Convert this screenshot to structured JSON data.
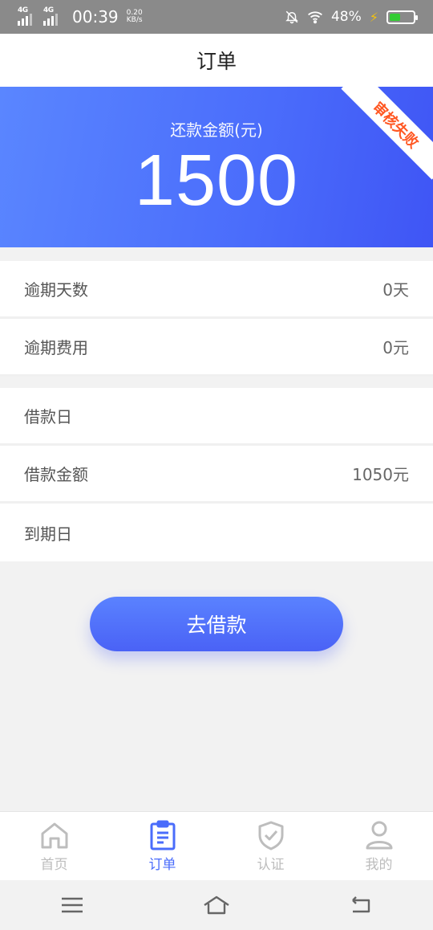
{
  "status_bar": {
    "net1": "4G",
    "net2": "4G",
    "time": "00:39",
    "speed_value": "0.20",
    "speed_unit": "KB/s",
    "battery": "48%",
    "battery_level": 0.48,
    "icons": [
      "signal-icon",
      "mute-bell-icon",
      "wifi-icon",
      "charging-icon",
      "battery-icon"
    ]
  },
  "header": {
    "title": "订单"
  },
  "hero": {
    "label": "还款金额(元)",
    "amount": "1500",
    "ribbon": "审核失败",
    "colors": {
      "start": "#5a86ff",
      "end": "#3f55f5",
      "ribbon_text": "#ff5722"
    }
  },
  "details": {
    "group1": [
      {
        "label": "逾期天数",
        "value": "0天"
      },
      {
        "label": "逾期费用",
        "value": "0元"
      }
    ],
    "group2": [
      {
        "label": "借款日",
        "value": ""
      },
      {
        "label": "借款金额",
        "value": "1050元"
      },
      {
        "label": "到期日",
        "value": ""
      }
    ]
  },
  "cta": {
    "label": "去借款"
  },
  "bottom_nav": {
    "items": [
      {
        "label": "首页",
        "icon": "home-icon",
        "active": false
      },
      {
        "label": "订单",
        "icon": "order-icon",
        "active": true
      },
      {
        "label": "认证",
        "icon": "shield-check-icon",
        "active": false
      },
      {
        "label": "我的",
        "icon": "user-icon",
        "active": false
      }
    ],
    "active_color": "#4a6cfb"
  },
  "system_nav": {
    "icons": [
      "menu-icon",
      "home-outline-icon",
      "back-icon"
    ]
  }
}
